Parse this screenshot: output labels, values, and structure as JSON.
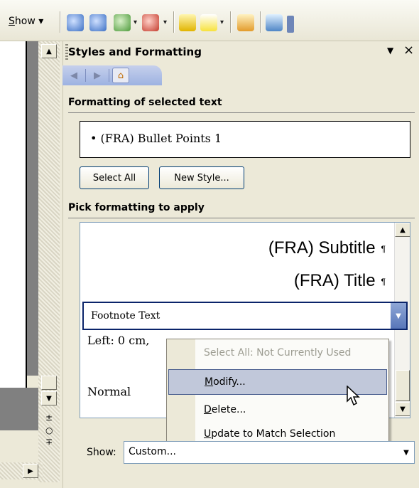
{
  "toolbar": {
    "show_label_prefix": "S",
    "show_label_rest": "how",
    "dropdown_arrow": "▾"
  },
  "pane": {
    "title": "Styles and Formatting",
    "menu_arrow": "▼",
    "close": "×",
    "nav": {
      "back_icon": "◀",
      "forward_icon": "▶",
      "home_icon": "⌂"
    }
  },
  "selected": {
    "heading": "Formatting of selected text",
    "value": "•  (FRA) Bullet Points 1",
    "select_all": "Select All",
    "new_style": "New Style..."
  },
  "pick": {
    "heading": "Pick formatting to apply",
    "items": [
      {
        "label": "(FRA) Subtitle",
        "mark": "¶"
      },
      {
        "label": "(FRA) Title",
        "mark": "¶"
      }
    ],
    "footnote": "Footnote Text",
    "left_line": "Left:  0 cm,",
    "normal_line": "Normal"
  },
  "context_menu": {
    "items": [
      {
        "label": "Select All: Not Currently Used",
        "disabled": true
      },
      {
        "u": "M",
        "rest": "odify...",
        "highlighted": true
      },
      {
        "u": "D",
        "rest": "elete..."
      },
      {
        "u": "U",
        "rest": "pdate to Match Selection"
      }
    ]
  },
  "show": {
    "label": "Show:",
    "value": "Custom..."
  },
  "colors": {
    "accent": "#0a246a",
    "highlight": "#c1c8da",
    "pane_bg": "#ece9d8"
  }
}
